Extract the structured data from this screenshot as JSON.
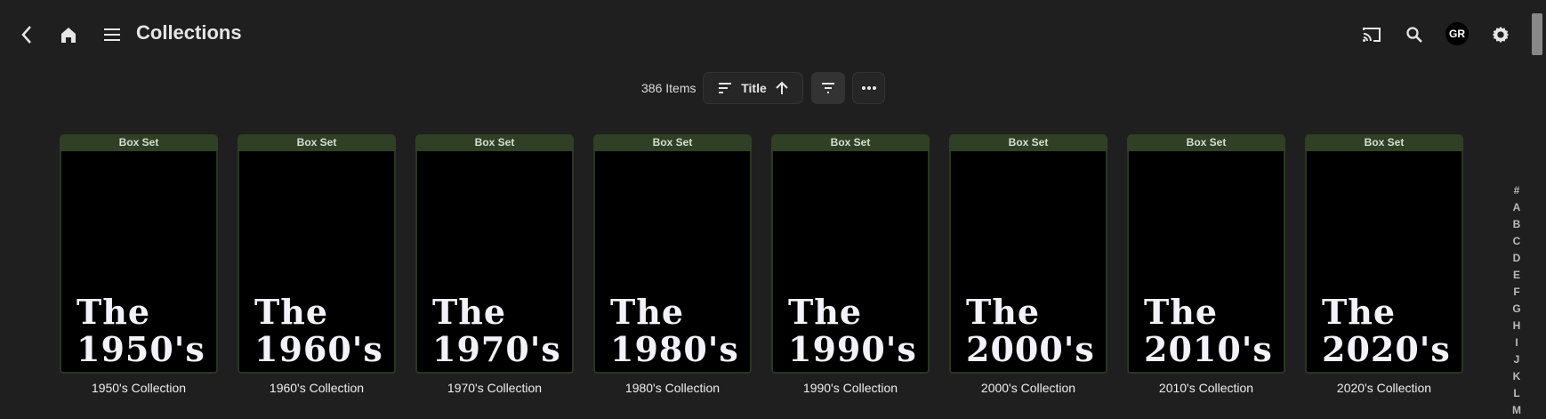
{
  "header": {
    "title": "Collections",
    "avatar_initials": "GR"
  },
  "toolbar": {
    "count": "386 Items",
    "sort_label": "Title"
  },
  "cards": [
    {
      "badge": "Box Set",
      "poster_line1": "The",
      "poster_line2": "1950's",
      "caption": "1950's Collection"
    },
    {
      "badge": "Box Set",
      "poster_line1": "The",
      "poster_line2": "1960's",
      "caption": "1960's Collection"
    },
    {
      "badge": "Box Set",
      "poster_line1": "The",
      "poster_line2": "1970's",
      "caption": "1970's Collection"
    },
    {
      "badge": "Box Set",
      "poster_line1": "The",
      "poster_line2": "1980's",
      "caption": "1980's Collection"
    },
    {
      "badge": "Box Set",
      "poster_line1": "The",
      "poster_line2": "1990's",
      "caption": "1990's Collection"
    },
    {
      "badge": "Box Set",
      "poster_line1": "The",
      "poster_line2": "2000's",
      "caption": "2000's Collection"
    },
    {
      "badge": "Box Set",
      "poster_line1": "The",
      "poster_line2": "2010's",
      "caption": "2010's Collection"
    },
    {
      "badge": "Box Set",
      "poster_line1": "The",
      "poster_line2": "2020's",
      "caption": "2020's Collection"
    }
  ],
  "alphabet": [
    "#",
    "A",
    "B",
    "C",
    "D",
    "E",
    "F",
    "G",
    "H",
    "I",
    "J",
    "K",
    "L",
    "M"
  ]
}
